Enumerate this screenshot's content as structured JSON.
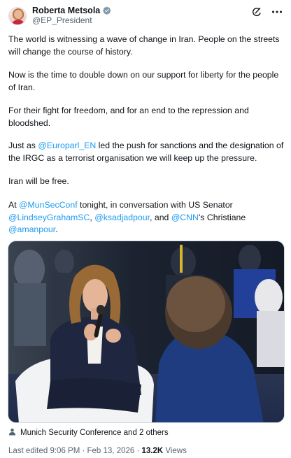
{
  "author": {
    "display_name": "Roberta Metsola",
    "handle": "@EP_President"
  },
  "icons": {
    "verified": "verified-badge-icon",
    "grok": "grok-icon",
    "more": "more-icon",
    "location": "person-tag-icon"
  },
  "colors": {
    "link": "#1d9bf0",
    "verified": "#829aab",
    "text": "#0f1419",
    "secondary": "#536471"
  },
  "post": {
    "p1": "The world is witnessing a wave of change in Iran. People on the streets will change the course of history.",
    "p2": "Now is the time to double down on our support for liberty for the people of Iran.",
    "p3": "For their fight for freedom, and for an end to the repression and bloodshed.",
    "p4_pre": "Just as ",
    "p4_mention": "@Europarl_EN",
    "p4_post": " led the push for sanctions and the designation of the IRGC as a terrorist organisation we will keep up the pressure.",
    "p5": "Iran will be free.",
    "p6_pre": "At ",
    "p6_m1": "@MunSecConf",
    "p6_mid1": " tonight, in conversation with US Senator ",
    "p6_m2": "@LindseyGrahamSC",
    "p6_mid2": ", ",
    "p6_m3": "@ksadjadpour",
    "p6_mid3": ", and ",
    "p6_m4": "@CNN",
    "p6_mid4": "'s Christiane ",
    "p6_m5": "@amanpour",
    "p6_end": "."
  },
  "tagged": "Munich Security Conference and 2 others",
  "meta": {
    "edited": "Last edited 9:06 PM · Feb 13, 2026 · ",
    "views_count": "13.2K",
    "views_label": " Views"
  }
}
